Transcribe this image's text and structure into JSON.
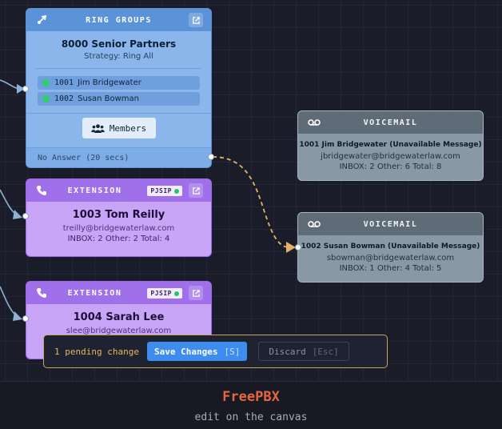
{
  "ring_group": {
    "header": "RING GROUPS",
    "name": "8000 Senior Partners",
    "strategy": "Strategy: Ring All",
    "members": [
      {
        "number": "1001",
        "name": "Jim Bridgewater"
      },
      {
        "number": "1002",
        "name": "Susan Bowman"
      }
    ],
    "members_button": "Members",
    "no_answer": "No Answer (20 secs)"
  },
  "extensions": [
    {
      "header": "EXTENSION",
      "badge": "PJSIP",
      "name": "1003 Tom Reilly",
      "email": "treilly@bridgewaterlaw.com",
      "stats": "INBOX: 2 Other: 2 Total: 4"
    },
    {
      "header": "EXTENSION",
      "badge": "PJSIP",
      "name": "1004 Sarah Lee",
      "email": "slee@bridgewaterlaw.com",
      "stats": ""
    }
  ],
  "voicemails": [
    {
      "header": "VOICEMAIL",
      "name": "1001 Jim Bridgewater (Unavailable Message)",
      "email": "jbridgewater@bridgewaterlaw.com",
      "stats": "INBOX: 2 Other: 6 Total: 8"
    },
    {
      "header": "VOICEMAIL",
      "name": "1002 Susan Bowman (Unavailable Message)",
      "email": "sbowman@bridgewaterlaw.com",
      "stats": "INBOX: 1 Other: 4 Total: 5"
    }
  ],
  "pending_bar": {
    "message": "1 pending change",
    "save_label": "Save Changes",
    "save_shortcut": "[S]",
    "discard_label": "Discard",
    "discard_shortcut": "[Esc]"
  },
  "footer": {
    "brand": "FreePBX",
    "tagline": "edit on the canvas"
  },
  "colors": {
    "ring_group": "#8ab6ec",
    "extension": "#c8a5f7",
    "voicemail": "#8898a5",
    "accent_save": "#3f8cf0",
    "pending_border": "#c9a65a",
    "brand": "#e8663b",
    "dashed_edge": "#e2b266"
  },
  "icons": {
    "ring_group": "ring-group-icon",
    "extension": "phone-icon",
    "voicemail": "voicemail-icon",
    "open": "external-link-icon",
    "members": "users-icon"
  }
}
